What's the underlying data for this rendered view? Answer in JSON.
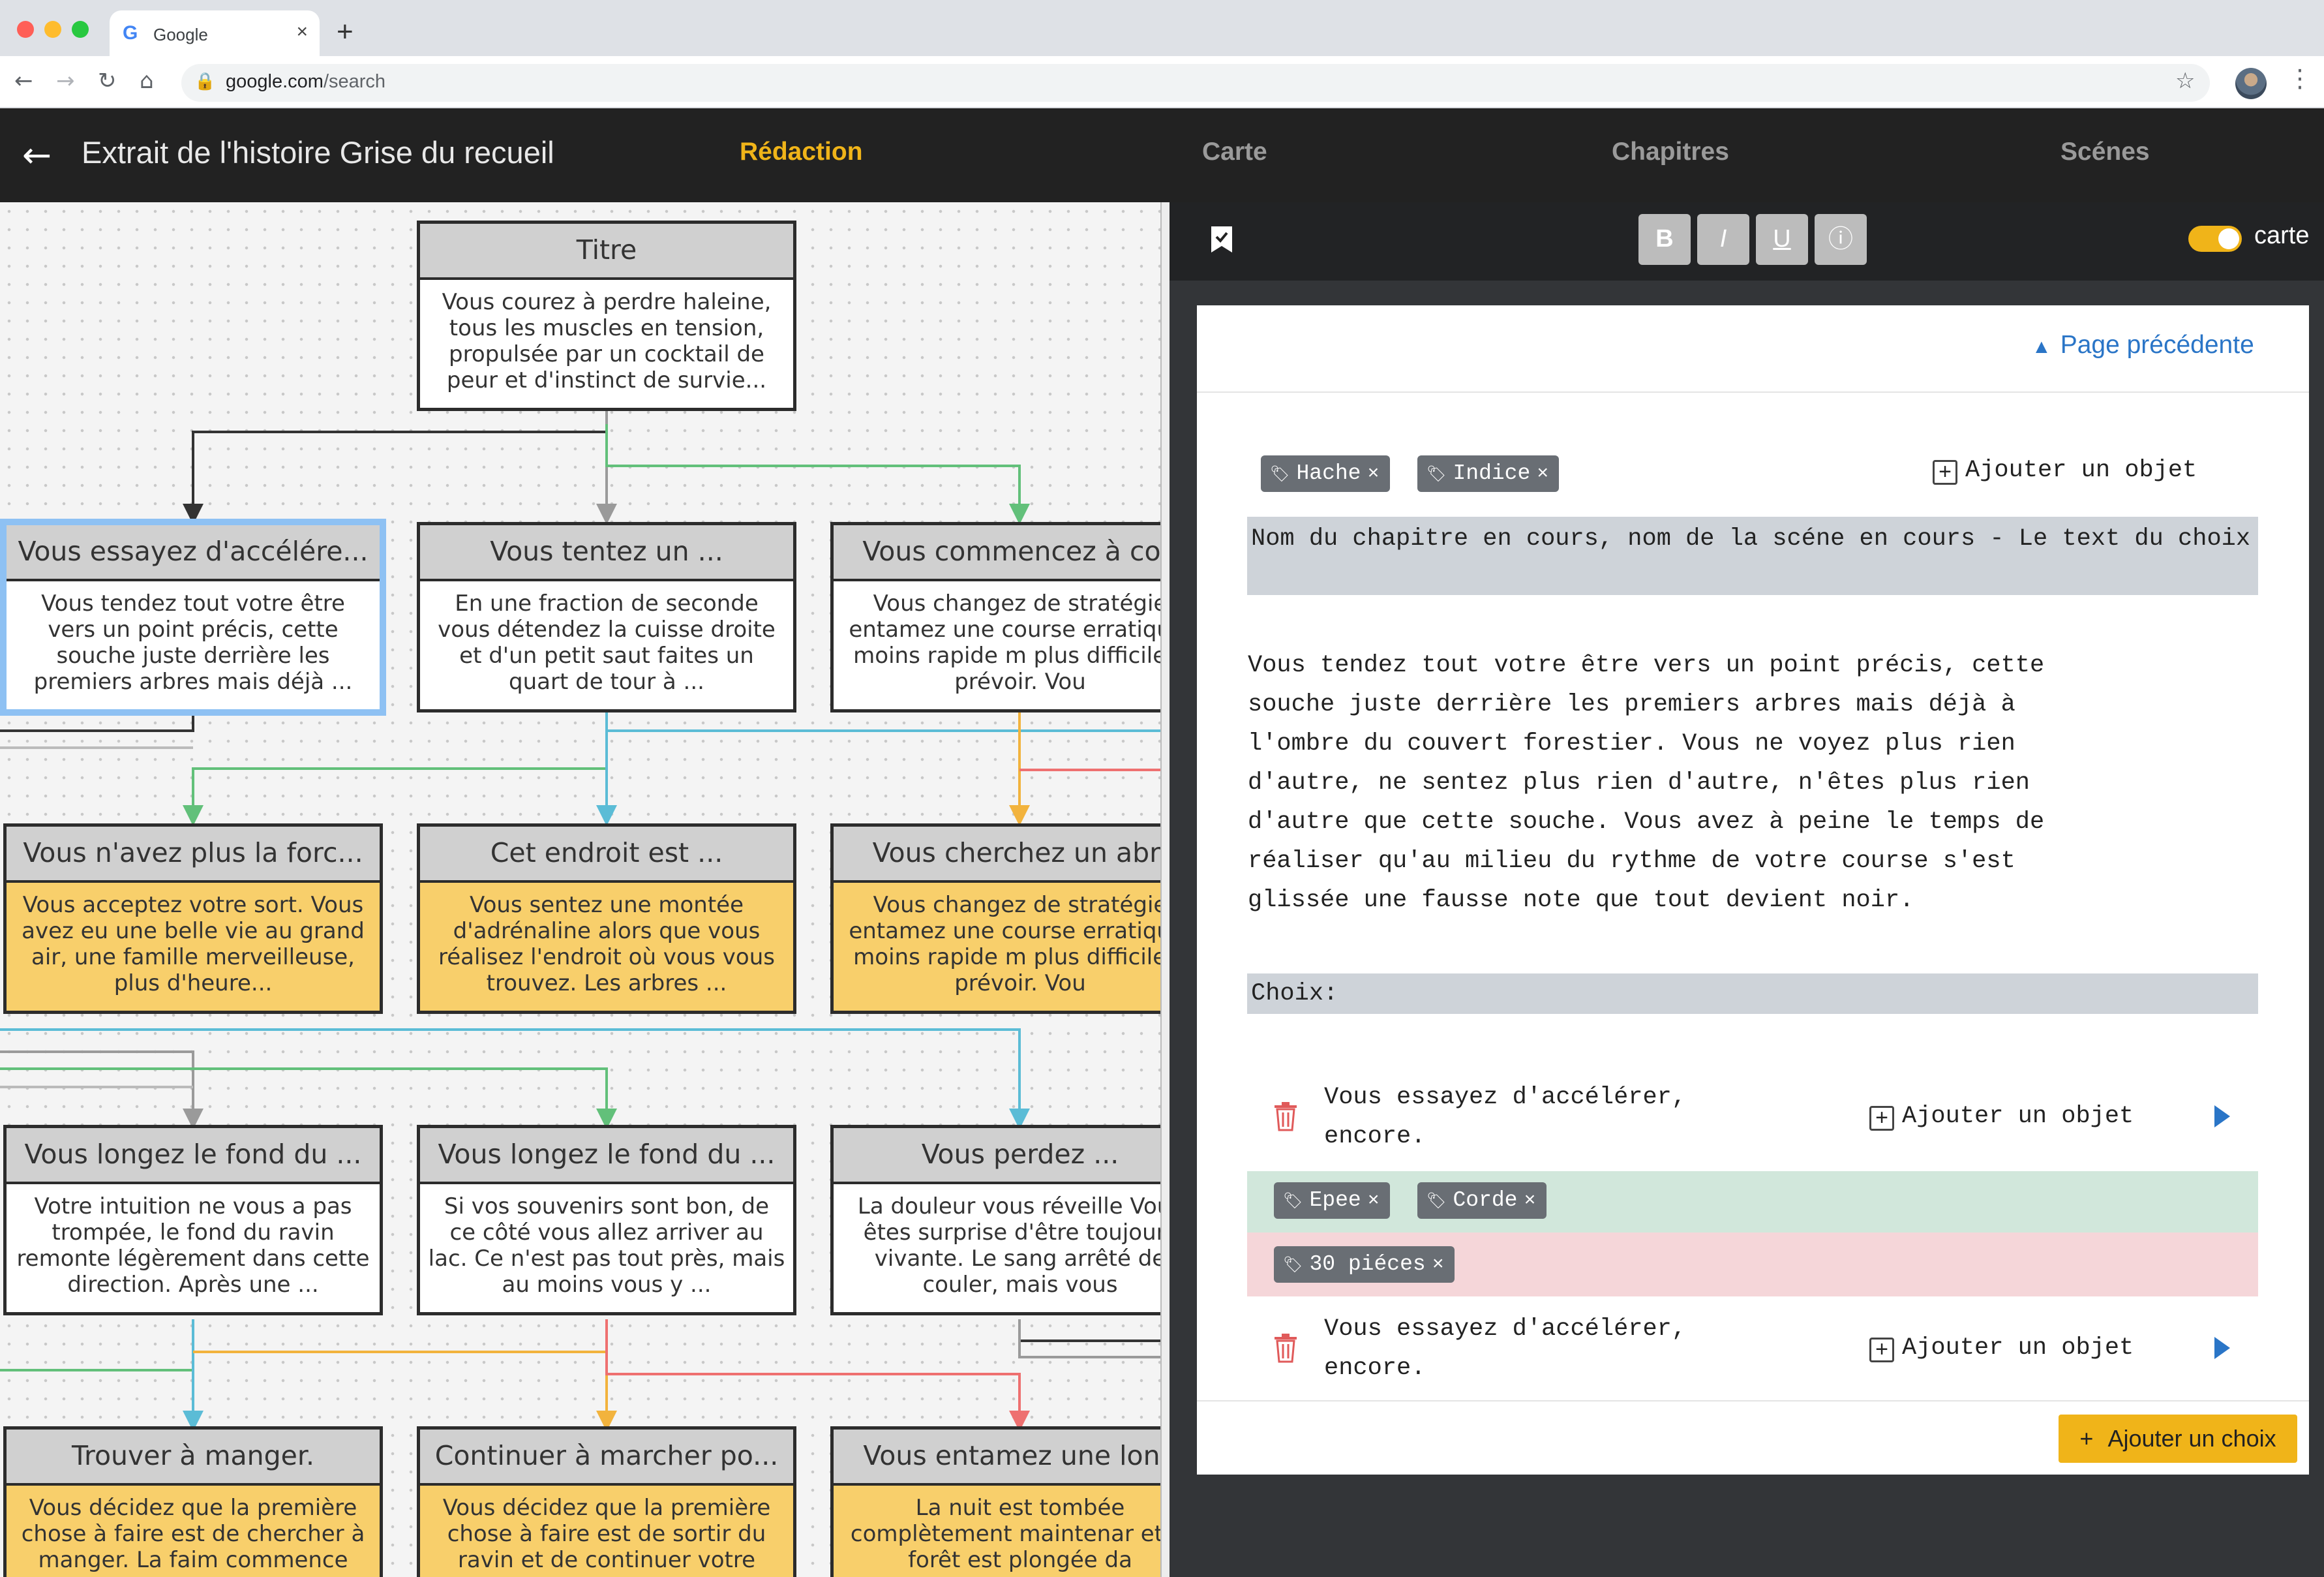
{
  "browser": {
    "tab_title": "Google",
    "tab_favicon": "G",
    "close_glyph": "×",
    "new_tab_glyph": "+",
    "url_host": "google.com",
    "url_path": "/search",
    "back_glyph": "←",
    "forward_glyph": "→",
    "reload_glyph": "↻",
    "home_glyph": "⌂",
    "lock_glyph": "🔒",
    "star_glyph": "☆",
    "menu_glyph": "⋮",
    "colors": {
      "close": "#ff5f57",
      "minimize": "#febc2e",
      "maximize": "#28c840"
    }
  },
  "app": {
    "back_glyph": "←",
    "story_title": "Extrait de l'histoire Grise du recueil",
    "nav": [
      {
        "label": "Rédaction",
        "active": true
      },
      {
        "label": "Carte",
        "active": false
      },
      {
        "label": "Chapitres",
        "active": false
      },
      {
        "label": "Scénes",
        "active": false
      }
    ],
    "accent_color": "#f0b419"
  },
  "graph": {
    "nodes": [
      {
        "title": "Titre",
        "text": "Vous courez à perdre haleine, tous les muscles en tension, propulsée par un cocktail de peur et d'instinct de survie...",
        "style": "white"
      },
      {
        "title": "Vous essayez d'accélére...",
        "text": "Vous tendez tout votre être vers un point précis, cette souche juste derrière les premiers arbres mais déjà ...",
        "style": "white",
        "selected": true
      },
      {
        "title": "Vous tentez un ...",
        "text": "En une fraction de seconde vous détendez la cuisse droite et d'un petit saut faites un quart de tour à ...",
        "style": "white"
      },
      {
        "title": "Vous commencez à cou",
        "text": "Vous changez de stratégie entamez une course erratique, moins rapide m plus difficile à prévoir. Vou",
        "style": "white"
      },
      {
        "title": "Vous n'avez plus la forc...",
        "text": "Vous acceptez votre sort. Vous avez eu une belle vie au grand air, une famille merveilleuse, plus d'heure...",
        "style": "yellow"
      },
      {
        "title": "Cet endroit est ...",
        "text": "Vous sentez une montée d'adrénaline alors que vous réalisez l'endroit où vous vous trouvez. Les arbres ...",
        "style": "yellow"
      },
      {
        "title": "Vous cherchez un abri",
        "text": "Vous changez de stratégie entamez une course erratique, moins rapide m plus difficile à prévoir. Vou",
        "style": "yellow"
      },
      {
        "title": "Vous longez le fond du ...",
        "text": "Votre intuition ne vous a pas trompée, le fond du ravin remonte légèrement dans cette direction. Après une ...",
        "style": "white"
      },
      {
        "title": "Vous longez le fond du ...",
        "text": "Si vos souvenirs sont bon, de ce côté vous allez arriver au lac. Ce n'est pas tout près, mais au moins vous y ...",
        "style": "white"
      },
      {
        "title": "Vous perdez ...",
        "text": "La douleur vous réveille Vous êtes surprise d'être toujours vivante. Le sang arrêté de couler, mais vous",
        "style": "white"
      },
      {
        "title": "Trouver à manger.",
        "text": "Vous décidez que la première chose à faire est de chercher à manger. La faim commence",
        "style": "yellow"
      },
      {
        "title": "Continuer à marcher po...",
        "text": "Vous décidez que la première chose à faire est de sortir du ravin et de continuer votre",
        "style": "yellow"
      },
      {
        "title": "Vous entamez une long",
        "text": "La nuit est tombée complètement maintenar et la forêt est plongée da",
        "style": "yellow"
      }
    ],
    "edge_colors": {
      "dark": "#333333",
      "gray": "#9a9a9a",
      "green": "#62c07a",
      "blue": "#5bbcd6",
      "orange": "#f2b33d",
      "red": "#ee7070"
    }
  },
  "editor": {
    "bookmark_icon": "bookmark",
    "format_buttons": [
      {
        "label": "B",
        "name": "bold"
      },
      {
        "label": "I",
        "name": "italic"
      },
      {
        "label": "U",
        "name": "underline"
      },
      {
        "label": "ⓘ",
        "name": "info"
      }
    ],
    "toggle_label": "carte",
    "toggle_on": true,
    "prev_page_glyph": "▲",
    "prev_page": "Page précédente",
    "tag_icon": "🏷",
    "tag_close": "×",
    "plus_glyph": "+",
    "scene_tags": [
      "Hache",
      "Indice"
    ],
    "add_object": "Ajouter un objet",
    "heading": "Nom du chapitre en cours, nom de la scéne en cours - Le text du choix",
    "body": "Vous tendez tout votre être vers un point précis, cette\nsouche juste derrière les premiers arbres mais déjà à\nl'ombre du couvert forestier. Vous ne voyez plus rien\nd'autre, ne sentez plus rien d'autre, n'êtes plus rien\nd'autre que cette souche. Vous avez à peine le temps de\nréaliser qu'au milieu du rythme de votre course s'est\nglissée une fausse note que tout devient noir.",
    "choices_label": "Choix:",
    "choices": [
      {
        "text": "Vous essayez d'accélérer,\nencore.",
        "add_object": "Ajouter un objet",
        "gain_tags": [
          "Epee",
          "Corde"
        ],
        "loss_tags": [
          "30 piéces"
        ]
      },
      {
        "text": "Vous essayez d'accélérer,\nencore.",
        "add_object": "Ajouter un objet"
      }
    ],
    "add_choice": "Ajouter un choix",
    "band_colors": {
      "gain": "#d1e7db",
      "loss": "#f5d6d9"
    }
  }
}
